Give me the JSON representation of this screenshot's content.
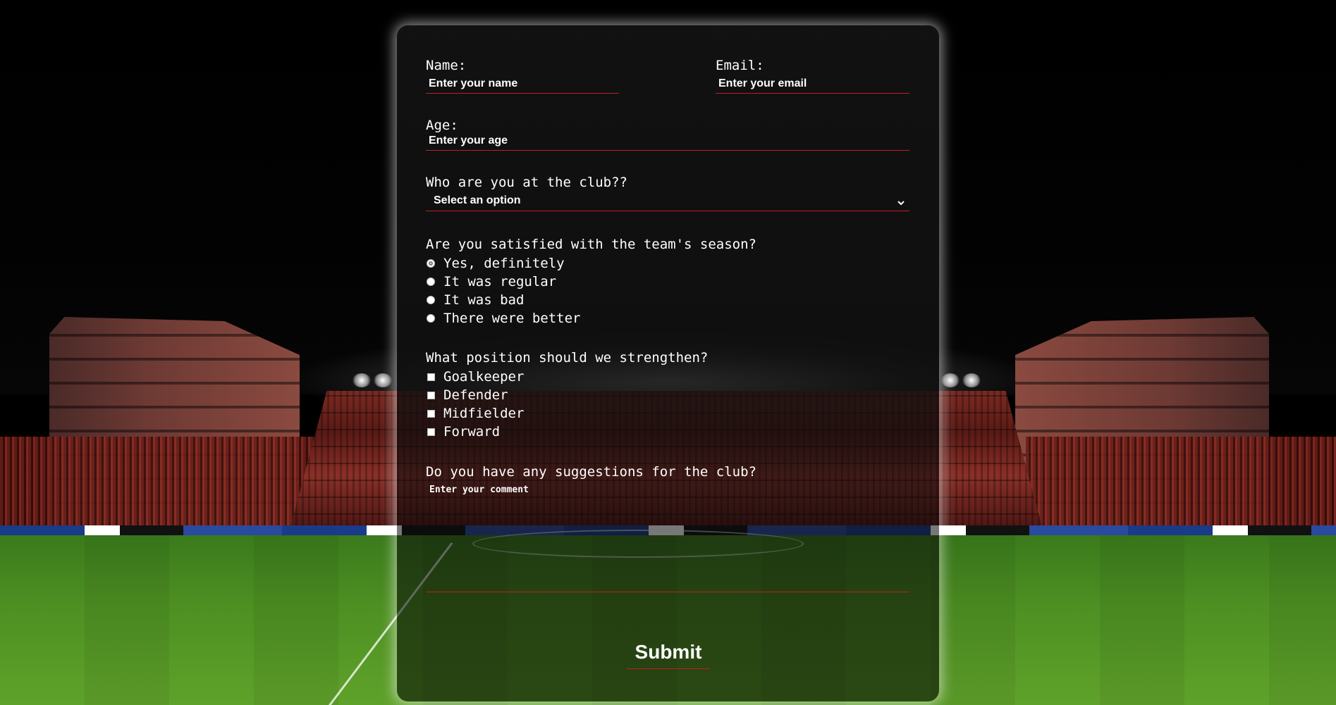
{
  "form": {
    "name": {
      "label": "Name:",
      "placeholder": "Enter your name"
    },
    "email": {
      "label": "Email:",
      "placeholder": "Enter your email"
    },
    "age": {
      "label": "Age:",
      "placeholder": "Enter your age"
    },
    "role": {
      "label": "Who are you at the club??",
      "selected": "Select an option"
    },
    "satisfaction": {
      "label": "Are you satisfied with the team's season?",
      "options": [
        "Yes, definitely",
        "It was regular",
        "It was bad",
        "There were better"
      ],
      "checked_index": 0
    },
    "position": {
      "label": "What position should we strengthen?",
      "options": [
        "Goalkeeper",
        "Defender",
        "Midfielder",
        "Forward"
      ]
    },
    "suggestions": {
      "label": "Do you have any suggestions for the club?",
      "placeholder": "Enter your comment"
    },
    "submit_label": "Submit"
  },
  "colors": {
    "accent_underline": "#c0201c",
    "text": "#ffffff",
    "card_background": "#121212"
  },
  "icons": {
    "select": "chevron-down-icon"
  }
}
